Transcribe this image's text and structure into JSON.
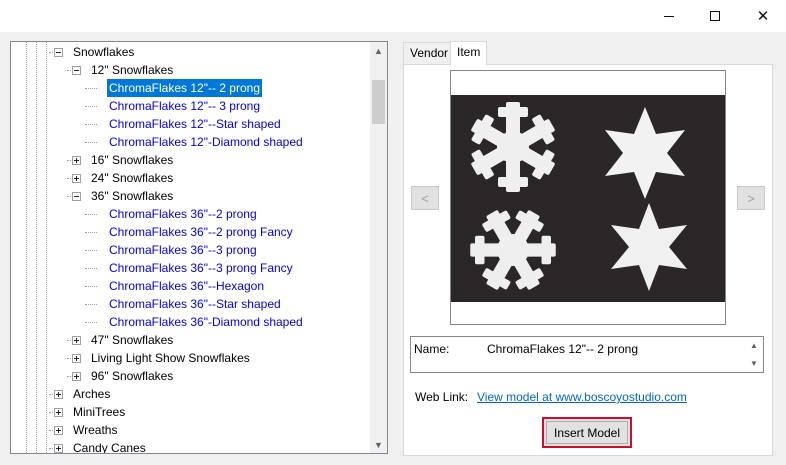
{
  "window": {
    "minimize_icon": "minimize-icon",
    "maximize_icon": "maximize-icon",
    "close_icon": "close-icon",
    "close_glyph": "✕"
  },
  "tree": {
    "items": [
      {
        "label": "Snowflakes",
        "kind": "folder",
        "state": "expanded"
      },
      {
        "label": "12\" Snowflakes",
        "kind": "folder",
        "state": "expanded"
      },
      {
        "label": "ChromaFlakes 12\"-- 2 prong",
        "kind": "leaf",
        "selected": true
      },
      {
        "label": "ChromaFlakes 12\"-- 3 prong",
        "kind": "leaf"
      },
      {
        "label": "ChromaFlakes 12\"--Star shaped",
        "kind": "leaf"
      },
      {
        "label": "ChromaFlakes 12\"-Diamond shaped",
        "kind": "leaf"
      },
      {
        "label": "16\" Snowflakes",
        "kind": "folder",
        "state": "collapsed"
      },
      {
        "label": "24\" Snowflakes",
        "kind": "folder",
        "state": "collapsed"
      },
      {
        "label": "36\" Snowflakes",
        "kind": "folder",
        "state": "expanded"
      },
      {
        "label": "ChromaFlakes 36\"--2 prong",
        "kind": "leaf"
      },
      {
        "label": "ChromaFlakes 36\"--2 prong Fancy",
        "kind": "leaf"
      },
      {
        "label": "ChromaFlakes 36\"--3 prong",
        "kind": "leaf"
      },
      {
        "label": "ChromaFlakes 36\"--3 prong Fancy",
        "kind": "leaf"
      },
      {
        "label": "ChromaFlakes 36\"--Hexagon",
        "kind": "leaf"
      },
      {
        "label": "ChromaFlakes 36\"--Star shaped",
        "kind": "leaf"
      },
      {
        "label": "ChromaFlakes 36\"-Diamond shaped",
        "kind": "leaf"
      },
      {
        "label": "47\" Snowflakes",
        "kind": "folder",
        "state": "collapsed"
      },
      {
        "label": "Living Light Show Snowflakes",
        "kind": "folder",
        "state": "collapsed"
      },
      {
        "label": "96\" Snowflakes",
        "kind": "folder",
        "state": "collapsed"
      },
      {
        "label": "Arches",
        "kind": "folder",
        "state": "collapsed"
      },
      {
        "label": "MiniTrees",
        "kind": "folder",
        "state": "collapsed"
      },
      {
        "label": "Wreaths",
        "kind": "folder",
        "state": "collapsed"
      },
      {
        "label": "Candy Canes",
        "kind": "folder",
        "state": "collapsed"
      }
    ],
    "scroll_up": "▲",
    "scroll_down": "▼"
  },
  "tabs": [
    {
      "label": "Vendor",
      "active": false
    },
    {
      "label": "Item",
      "active": true
    }
  ],
  "preview": {
    "prev": "<",
    "next": ">"
  },
  "details": {
    "name_label": "Name:",
    "name_value": "ChromaFlakes 12\"-- 2 prong",
    "weblink_label": "Web Link:",
    "weblink_text": "View model at www.boscoyostudio.com",
    "insert_button": "Insert Model"
  },
  "colors": {
    "selection": "#0078d7",
    "link": "#0000ee",
    "highlight_border": "#c8102e"
  }
}
